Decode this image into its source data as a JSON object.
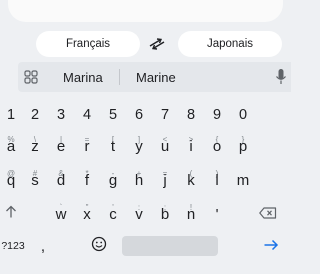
{
  "translate": {
    "source_lang": "Français",
    "target_lang": "Japonais"
  },
  "suggestions": [
    "Marina",
    "Marine"
  ],
  "number_row": [
    "1",
    "2",
    "3",
    "4",
    "5",
    "6",
    "7",
    "8",
    "9",
    "0"
  ],
  "row1": [
    {
      "k": "a",
      "h": "%"
    },
    {
      "k": "z",
      "h": "\\"
    },
    {
      "k": "e",
      "h": "|"
    },
    {
      "k": "r",
      "h": "="
    },
    {
      "k": "t",
      "h": "["
    },
    {
      "k": "y",
      "h": "]"
    },
    {
      "k": "u",
      "h": "<"
    },
    {
      "k": "i",
      "h": ">"
    },
    {
      "k": "o",
      "h": "{"
    },
    {
      "k": "p",
      "h": "}"
    }
  ],
  "row2": [
    {
      "k": "q",
      "h": "@"
    },
    {
      "k": "s",
      "h": "#"
    },
    {
      "k": "d",
      "h": "&"
    },
    {
      "k": "f",
      "h": "*"
    },
    {
      "k": "g",
      "h": "-"
    },
    {
      "k": "h",
      "h": "+"
    },
    {
      "k": "j",
      "h": "="
    },
    {
      "k": "k",
      "h": "("
    },
    {
      "k": "l",
      "h": ")"
    },
    {
      "k": "m",
      "h": ""
    }
  ],
  "row3": [
    {
      "k": "w",
      "h": "`"
    },
    {
      "k": "x",
      "h": "\""
    },
    {
      "k": "c",
      "h": "'"
    },
    {
      "k": "v",
      "h": ":"
    },
    {
      "k": "b",
      "h": ";"
    },
    {
      "k": "n",
      "h": "!"
    },
    {
      "k": "'",
      "h": ""
    }
  ],
  "bottom": {
    "sym_label": "?123",
    "comma": ","
  },
  "colors": {
    "accent": "#1a73e8",
    "keyboard_bg": "#eef0f3"
  },
  "icons": [
    "swap-arrows-icon",
    "grid-menu-icon",
    "mic-icon",
    "shift-icon",
    "backspace-icon",
    "emoji-icon",
    "enter-arrow-icon"
  ]
}
